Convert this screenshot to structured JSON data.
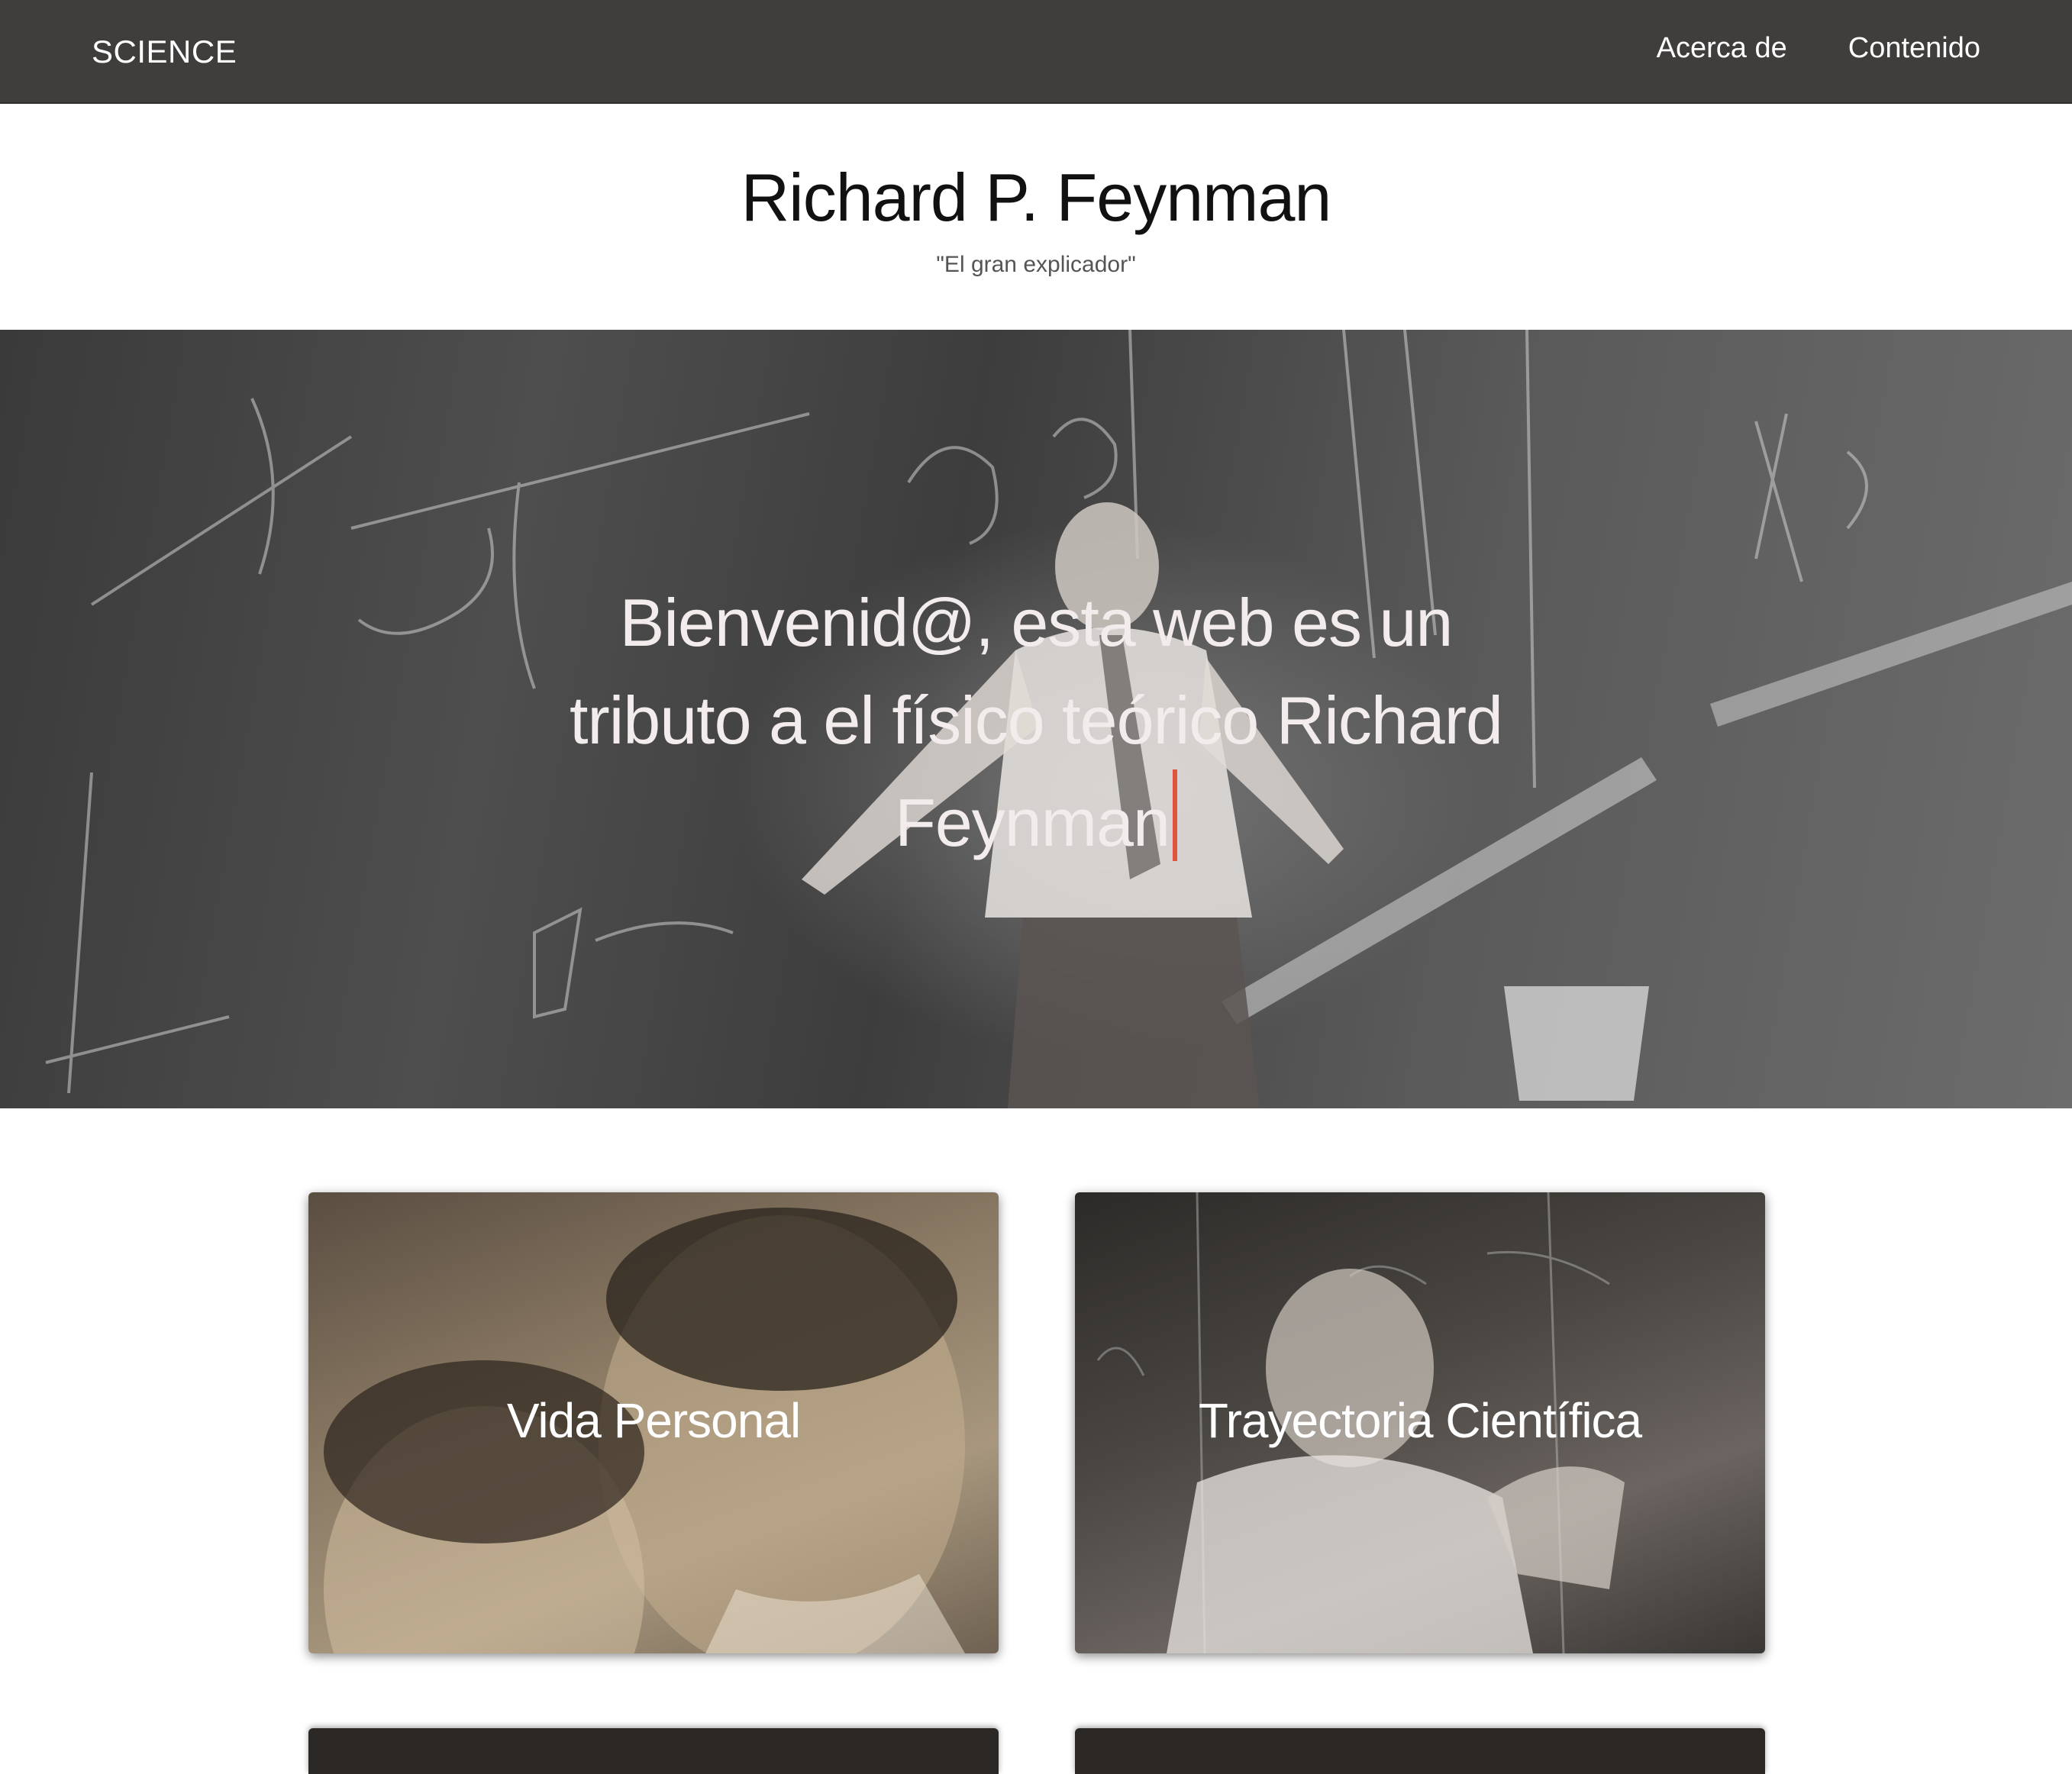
{
  "navbar": {
    "brand": "SCIENCE",
    "links": [
      {
        "label": "Acerca de"
      },
      {
        "label": "Contenido"
      }
    ]
  },
  "header": {
    "title": "Richard P. Feynman",
    "subtitle": "\"El gran explicador\""
  },
  "hero": {
    "text": "Bienvenid@, esta web es un tributo a el físico teórico Richard Feynman"
  },
  "cards": [
    {
      "title": "Vida Personal"
    },
    {
      "title": "Trayectoria Científica"
    }
  ],
  "colors": {
    "navbar_bg": "#403e3c",
    "cursor": "#e0533e"
  }
}
